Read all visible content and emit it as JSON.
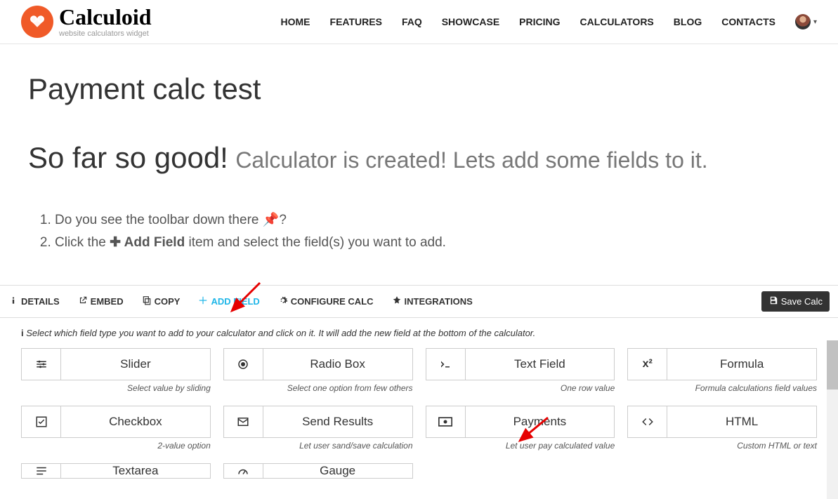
{
  "brand": {
    "name": "Calculoid",
    "tagline": "website calculators widget"
  },
  "nav": {
    "home": "HOME",
    "features": "FEATURES",
    "faq": "FAQ",
    "showcase": "SHOWCASE",
    "pricing": "PRICING",
    "calculators": "CALCULATORS",
    "blog": "BLOG",
    "contacts": "CONTACTS"
  },
  "page": {
    "title": "Payment calc test",
    "subtitle_bold": "So far so good!",
    "subtitle_light": "Calculator is created! Lets add some fields to it.",
    "step1_a": "Do you see the toolbar down there ",
    "step1_b": "?",
    "step2_a": "Click the ",
    "step2_icon_label": " Add Field",
    "step2_b": " item and select the field(s) you want to add."
  },
  "toolbar": {
    "details": "DETAILS",
    "embed": "EMBED",
    "copy": "COPY",
    "add_field": "ADD FIELD",
    "configure": "CONFIGURE CALC",
    "integrations": "INTEGRATIONS",
    "save": "Save Calc"
  },
  "help": "Select which field type you want to add to your calculator and click on it. It will add the new field at the bottom of the calculator.",
  "fields": {
    "slider": {
      "label": "Slider",
      "desc": "Select value by sliding"
    },
    "radio": {
      "label": "Radio Box",
      "desc": "Select one option from few others"
    },
    "text": {
      "label": "Text Field",
      "desc": "One row value"
    },
    "formula": {
      "label": "Formula",
      "desc": "Formula calculations field values"
    },
    "checkbox": {
      "label": "Checkbox",
      "desc": "2-value option"
    },
    "send": {
      "label": "Send Results",
      "desc": "Let user sand/save calculation"
    },
    "payments": {
      "label": "Payments",
      "desc": "Let user pay calculated value"
    },
    "html": {
      "label": "HTML",
      "desc": "Custom HTML or text"
    },
    "textarea": {
      "label": "Textarea",
      "desc": ""
    },
    "gauge": {
      "label": "Gauge",
      "desc": ""
    }
  }
}
